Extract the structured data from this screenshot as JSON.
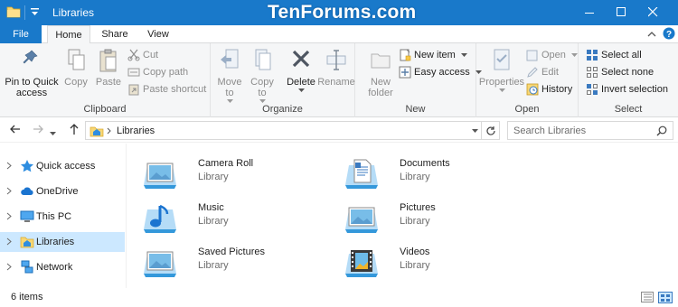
{
  "window": {
    "title": "Libraries",
    "watermark": "TenForums.com",
    "accent": "#1979ca"
  },
  "tabs": {
    "file": "File",
    "items": [
      "Home",
      "Share",
      "View"
    ],
    "active": "Home"
  },
  "ribbon": {
    "clipboard": {
      "label": "Clipboard",
      "pin": "Pin to Quick access",
      "copy": "Copy",
      "paste": "Paste",
      "cut": "Cut",
      "copy_path": "Copy path",
      "paste_shortcut": "Paste shortcut"
    },
    "organize": {
      "label": "Organize",
      "move_to": "Move to",
      "copy_to": "Copy to",
      "delete": "Delete",
      "rename": "Rename"
    },
    "new": {
      "label": "New",
      "new_folder": "New folder",
      "new_item": "New item",
      "easy_access": "Easy access"
    },
    "open": {
      "label": "Open",
      "properties": "Properties",
      "open": "Open",
      "edit": "Edit",
      "history": "History"
    },
    "select": {
      "label": "Select",
      "select_all": "Select all",
      "select_none": "Select none",
      "invert_selection": "Invert selection"
    }
  },
  "address": {
    "path": "Libraries",
    "search_placeholder": "Search Libraries"
  },
  "nav": {
    "items": [
      "Quick access",
      "OneDrive",
      "This PC",
      "Libraries",
      "Network"
    ],
    "selected": "Libraries"
  },
  "libraries": [
    {
      "name": "Camera Roll",
      "type": "Library",
      "icon": "pictures-library-icon"
    },
    {
      "name": "Documents",
      "type": "Library",
      "icon": "documents-library-icon"
    },
    {
      "name": "Music",
      "type": "Library",
      "icon": "music-library-icon"
    },
    {
      "name": "Pictures",
      "type": "Library",
      "icon": "pictures-library-icon"
    },
    {
      "name": "Saved Pictures",
      "type": "Library",
      "icon": "pictures-library-icon"
    },
    {
      "name": "Videos",
      "type": "Library",
      "icon": "videos-library-icon"
    }
  ],
  "status": {
    "count": "6 items"
  }
}
